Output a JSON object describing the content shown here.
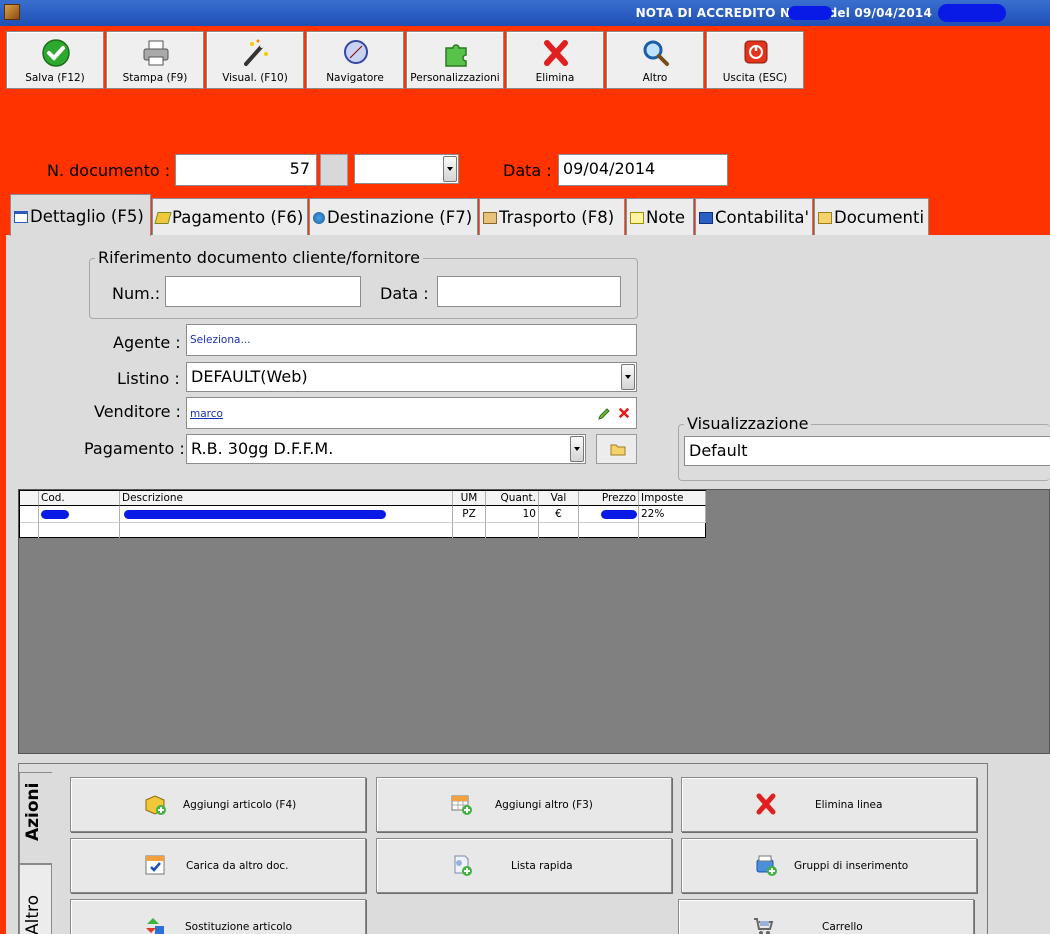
{
  "window": {
    "title": "NOTA DI ACCREDITO N. ____ del 09/04/2014"
  },
  "toolbar": [
    {
      "label": "Salva (F12)",
      "icon": "check-icon"
    },
    {
      "label": "Stampa (F9)",
      "icon": "printer-icon"
    },
    {
      "label": "Visual. (F10)",
      "icon": "magic-wand-icon"
    },
    {
      "label": "Navigatore",
      "icon": "compass-icon"
    },
    {
      "label": "Personalizzazioni",
      "icon": "puzzle-icon"
    },
    {
      "label": "Elimina",
      "icon": "delete-x-icon"
    },
    {
      "label": "Altro",
      "icon": "search-icon"
    },
    {
      "label": "Uscita (ESC)",
      "icon": "power-icon"
    }
  ],
  "header": {
    "doc_label": "N. documento :",
    "doc_number": "57",
    "date_label": "Data :",
    "date_value": "09/04/2014"
  },
  "tabs": [
    {
      "label": "Dettaglio (F5)",
      "active": true
    },
    {
      "label": "Pagamento (F6)"
    },
    {
      "label": "Destinazione (F7)"
    },
    {
      "label": "Trasporto (F8)"
    },
    {
      "label": "Note"
    },
    {
      "label": "Contabilita'"
    },
    {
      "label": "Documenti"
    }
  ],
  "riferimento": {
    "title": "Riferimento documento cliente/fornitore",
    "num_label": "Num.:",
    "data_label": "Data :",
    "num_value": "",
    "data_value": ""
  },
  "form": {
    "agente_label": "Agente :",
    "agente_value": "Seleziona...",
    "listino_label": "Listino :",
    "listino_value": "DEFAULT(Web)",
    "venditore_label": "Venditore :",
    "venditore_value": "marco",
    "pagamento_label": "Pagamento :",
    "pagamento_value": "R.B. 30gg D.F.F.M."
  },
  "visualizzazione": {
    "title": "Visualizzazione",
    "value": "Default"
  },
  "grid": {
    "columns": [
      "Cod.",
      "Descrizione",
      "UM",
      "Quant.",
      "Val",
      "Prezzo",
      "Imposte"
    ],
    "rows": [
      {
        "um": "PZ",
        "quant": "10",
        "val": "€",
        "imposte": "22%"
      }
    ]
  },
  "actions": {
    "tabs": [
      "Azioni",
      "Altro"
    ],
    "buttons": [
      {
        "label": "Aggiungi articolo (F4)",
        "icon": "add-box-icon"
      },
      {
        "label": "Aggiungi altro (F3)",
        "icon": "add-grid-icon"
      },
      {
        "label": "Elimina linea",
        "icon": "delete-x-icon"
      },
      {
        "label": "Carica da altro doc.",
        "icon": "checklist-icon"
      },
      {
        "label": "Lista rapida",
        "icon": "quick-list-icon"
      },
      {
        "label": "Gruppi di inserimento",
        "icon": "group-add-icon"
      },
      {
        "label": "Sostituzione articolo",
        "icon": "replace-icon"
      },
      {
        "label": "Carrello",
        "icon": "cart-icon"
      }
    ]
  },
  "colors": {
    "background": "#ff3300",
    "panel": "#dcdcdc",
    "grid_area": "#808080",
    "title_bar": "#2456c2"
  }
}
